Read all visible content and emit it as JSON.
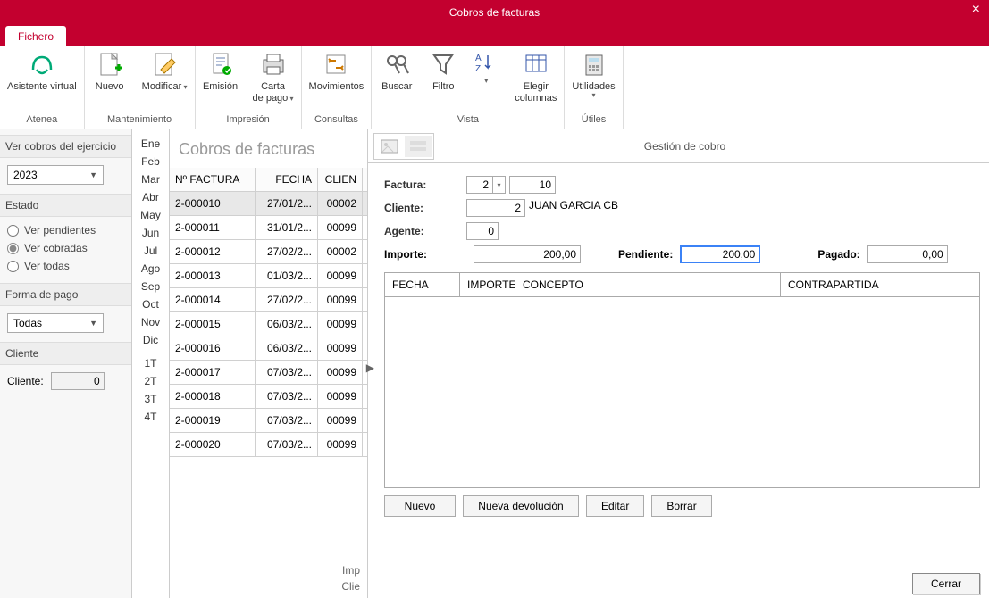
{
  "window": {
    "title": "Cobros de facturas"
  },
  "tabs": {
    "fichero": "Fichero"
  },
  "ribbon": {
    "atenea": {
      "label": "Asistente\nvirtual",
      "group": "Atenea"
    },
    "mantenimiento": {
      "nuevo": "Nuevo",
      "modificar": "Modificar",
      "group": "Mantenimiento"
    },
    "impresion": {
      "emision": "Emisión",
      "carta": "Carta\nde pago",
      "group": "Impresión"
    },
    "consultas": {
      "movimientos": "Movimientos",
      "group": "Consultas"
    },
    "vista": {
      "buscar": "Buscar",
      "filtro": "Filtro",
      "az": "",
      "elegir": "Elegir\ncolumnas",
      "group": "Vista"
    },
    "utiles": {
      "utilidades": "Utilidades",
      "group": "Útiles"
    }
  },
  "leftpanel": {
    "ejercicio_title": "Ver cobros del ejercicio",
    "year": "2023",
    "estado_title": "Estado",
    "r_pendientes": "Ver pendientes",
    "r_cobradas": "Ver cobradas",
    "r_todas": "Ver todas",
    "forma_title": "Forma de pago",
    "forma_value": "Todas",
    "cliente_title": "Cliente",
    "cliente_label": "Cliente:",
    "cliente_value": "0"
  },
  "months": [
    "Ene",
    "Feb",
    "Mar",
    "Abr",
    "May",
    "Jun",
    "Jul",
    "Ago",
    "Sep",
    "Oct",
    "Nov",
    "Dic",
    "",
    "1T",
    "2T",
    "3T",
    "4T"
  ],
  "table": {
    "title": "Cobros de facturas",
    "cols": {
      "nf": "Nº FACTURA",
      "fecha": "FECHA",
      "cliente": "CLIEN"
    },
    "rows": [
      {
        "nf": "2-000010",
        "fecha": "27/01/2...",
        "cl": "00002"
      },
      {
        "nf": "2-000011",
        "fecha": "31/01/2...",
        "cl": "00099"
      },
      {
        "nf": "2-000012",
        "fecha": "27/02/2...",
        "cl": "00002"
      },
      {
        "nf": "2-000013",
        "fecha": "01/03/2...",
        "cl": "00099"
      },
      {
        "nf": "2-000014",
        "fecha": "27/02/2...",
        "cl": "00099"
      },
      {
        "nf": "2-000015",
        "fecha": "06/03/2...",
        "cl": "00099"
      },
      {
        "nf": "2-000016",
        "fecha": "06/03/2...",
        "cl": "00099"
      },
      {
        "nf": "2-000017",
        "fecha": "07/03/2...",
        "cl": "00099"
      },
      {
        "nf": "2-000018",
        "fecha": "07/03/2...",
        "cl": "00099"
      },
      {
        "nf": "2-000019",
        "fecha": "07/03/2...",
        "cl": "00099"
      },
      {
        "nf": "2-000020",
        "fecha": "07/03/2...",
        "cl": "00099"
      }
    ],
    "footer1": "Imp",
    "footer2": "Clie"
  },
  "detail": {
    "title": "Gestión de cobro",
    "factura_label": "Factura:",
    "factura_serie": "2",
    "factura_num": "10",
    "cliente_label": "Cliente:",
    "cliente_id": "2",
    "cliente_name": "JUAN GARCIA CB",
    "agente_label": "Agente:",
    "agente_val": "0",
    "importe_label": "Importe:",
    "importe_val": "200,00",
    "pendiente_label": "Pendiente:",
    "pendiente_val": "200,00",
    "pagado_label": "Pagado:",
    "pagado_val": "0,00",
    "grid_cols": {
      "fecha": "FECHA",
      "importe": "IMPORTE",
      "concepto": "CONCEPTO",
      "contra": "CONTRAPARTIDA"
    },
    "actions": {
      "nuevo": "Nuevo",
      "nueva_dev": "Nueva devolución",
      "editar": "Editar",
      "borrar": "Borrar"
    }
  },
  "footer": {
    "cerrar": "Cerrar"
  }
}
